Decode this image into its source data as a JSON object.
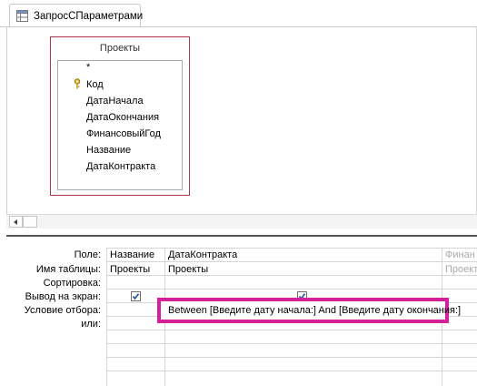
{
  "tab": {
    "title": "ЗапросСПараметрами",
    "icon": "query-icon"
  },
  "table": {
    "name": "Проекты",
    "fields": [
      "*",
      "Код",
      "ДатаНачала",
      "ДатаОкончания",
      "ФинансовыйГод",
      "Название",
      "ДатаКонтракта"
    ],
    "key_field_icon": "key-icon"
  },
  "grid": {
    "row_labels": {
      "field": "Поле:",
      "table": "Имя таблицы:",
      "sort": "Сортировка:",
      "show": "Вывод на экран:",
      "criteria": "Условие отбора:",
      "or": "или:"
    },
    "columns": [
      {
        "field": "Название",
        "table": "Проекты",
        "show": true,
        "criteria": ""
      },
      {
        "field": "ДатаКонтракта",
        "table": "Проекты",
        "show": true,
        "criteria": "Between [Введите дату начала:] And [Введите дату окончания:]"
      },
      {
        "field": "Финан",
        "table": "Проект",
        "show": false,
        "criteria": ""
      }
    ]
  },
  "colors": {
    "highlight": "#d4209c",
    "table_border": "#b3334a"
  }
}
